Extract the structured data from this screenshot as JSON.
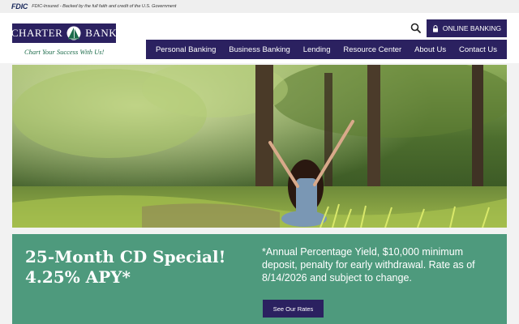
{
  "fdic": {
    "logo": "FDIC",
    "notice": "FDIC-Insured - Backed by the full faith and credit of the U.S. Government"
  },
  "brand": {
    "name_part1": "CHARTER",
    "name_part2": "BANK",
    "tagline": "Chart Your Success With Us!"
  },
  "header": {
    "search_icon": "search-icon",
    "online_banking_label": "ONLINE BANKING",
    "lock_icon": "lock-icon"
  },
  "nav": {
    "items": [
      {
        "label": "Personal Banking"
      },
      {
        "label": "Business Banking"
      },
      {
        "label": "Lending"
      },
      {
        "label": "Resource Center"
      },
      {
        "label": "About Us"
      },
      {
        "label": "Contact Us"
      }
    ]
  },
  "promo": {
    "title": "25-Month CD Special! 4.25% APY*",
    "disclaimer": "*Annual Percentage Yield, $10,000 minimum deposit, penalty for early withdrawal. Rate as of 8/14/2026 and subject to change.",
    "button_label": "See Our Rates"
  },
  "colors": {
    "brand_navy": "#2b2160",
    "promo_green": "#4e9a7d",
    "tagline_green": "#1c6b4a"
  }
}
